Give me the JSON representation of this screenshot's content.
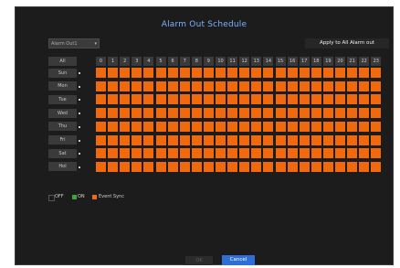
{
  "dialog": {
    "title": "Alarm Out Schedule"
  },
  "controls": {
    "alarm_select_value": "Alarm Out1",
    "apply_all_label": "Apply to All Alarm out"
  },
  "schedule": {
    "all_label": "All",
    "hours": [
      "0",
      "1",
      "2",
      "3",
      "4",
      "5",
      "6",
      "7",
      "8",
      "9",
      "10",
      "11",
      "12",
      "13",
      "14",
      "15",
      "16",
      "17",
      "18",
      "19",
      "20",
      "21",
      "22",
      "23"
    ],
    "days": [
      "Sun",
      "Mon",
      "Tue",
      "Wed",
      "Thu",
      "Fri",
      "Sat",
      "Hol"
    ],
    "cell_state": "Event Sync"
  },
  "legend": [
    {
      "label": "OFF",
      "color": "#1c1c1c"
    },
    {
      "label": "ON",
      "color": "#3aa63a"
    },
    {
      "label": "Event Sync",
      "color": "#f06a0d"
    }
  ],
  "buttons": {
    "ok_label": "OK",
    "cancel_label": "Cancel"
  },
  "colors": {
    "accent": "#2d6fd6",
    "title": "#7fb0ff",
    "event_sync": "#f06a0d"
  }
}
